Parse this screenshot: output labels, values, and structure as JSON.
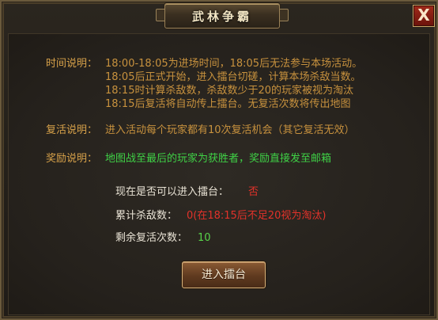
{
  "window": {
    "title": "武林争霸",
    "close_label": "X"
  },
  "rules": {
    "time_label": "时间说明：",
    "time_lines": [
      "18:00-18:05为进场时间，18:05后无法参与本场活动。",
      "18:05后正式开始，进入擂台切磋，计算本场杀敌当数。",
      "18:15时计算杀敌数，杀敌数少于20的玩家被视为淘汰",
      "18:15后复活将自动传上擂台。无复活次数将传出地图"
    ],
    "revive_label": "复活说明：",
    "revive_text": "进入活动每个玩家都有10次复活机会（其它复活无效）",
    "reward_label": "奖励说明：",
    "reward_text": "地图战至最后的玩家为获胜者，奖励直接发至邮箱"
  },
  "status": {
    "can_enter_label": "现在是否可以进入擂台：",
    "can_enter_value": "否",
    "kills_label": "累计杀敌数：",
    "kills_value": "0(在18:15后不足20视为淘汰)",
    "revives_label": "剩余复活次数：",
    "revives_value": "10"
  },
  "actions": {
    "enter_label": "进入擂台"
  },
  "colors": {
    "label": "#d8a24a",
    "reward": "#3fd146",
    "value_red": "#e2322a",
    "value_green": "#58d34a"
  }
}
